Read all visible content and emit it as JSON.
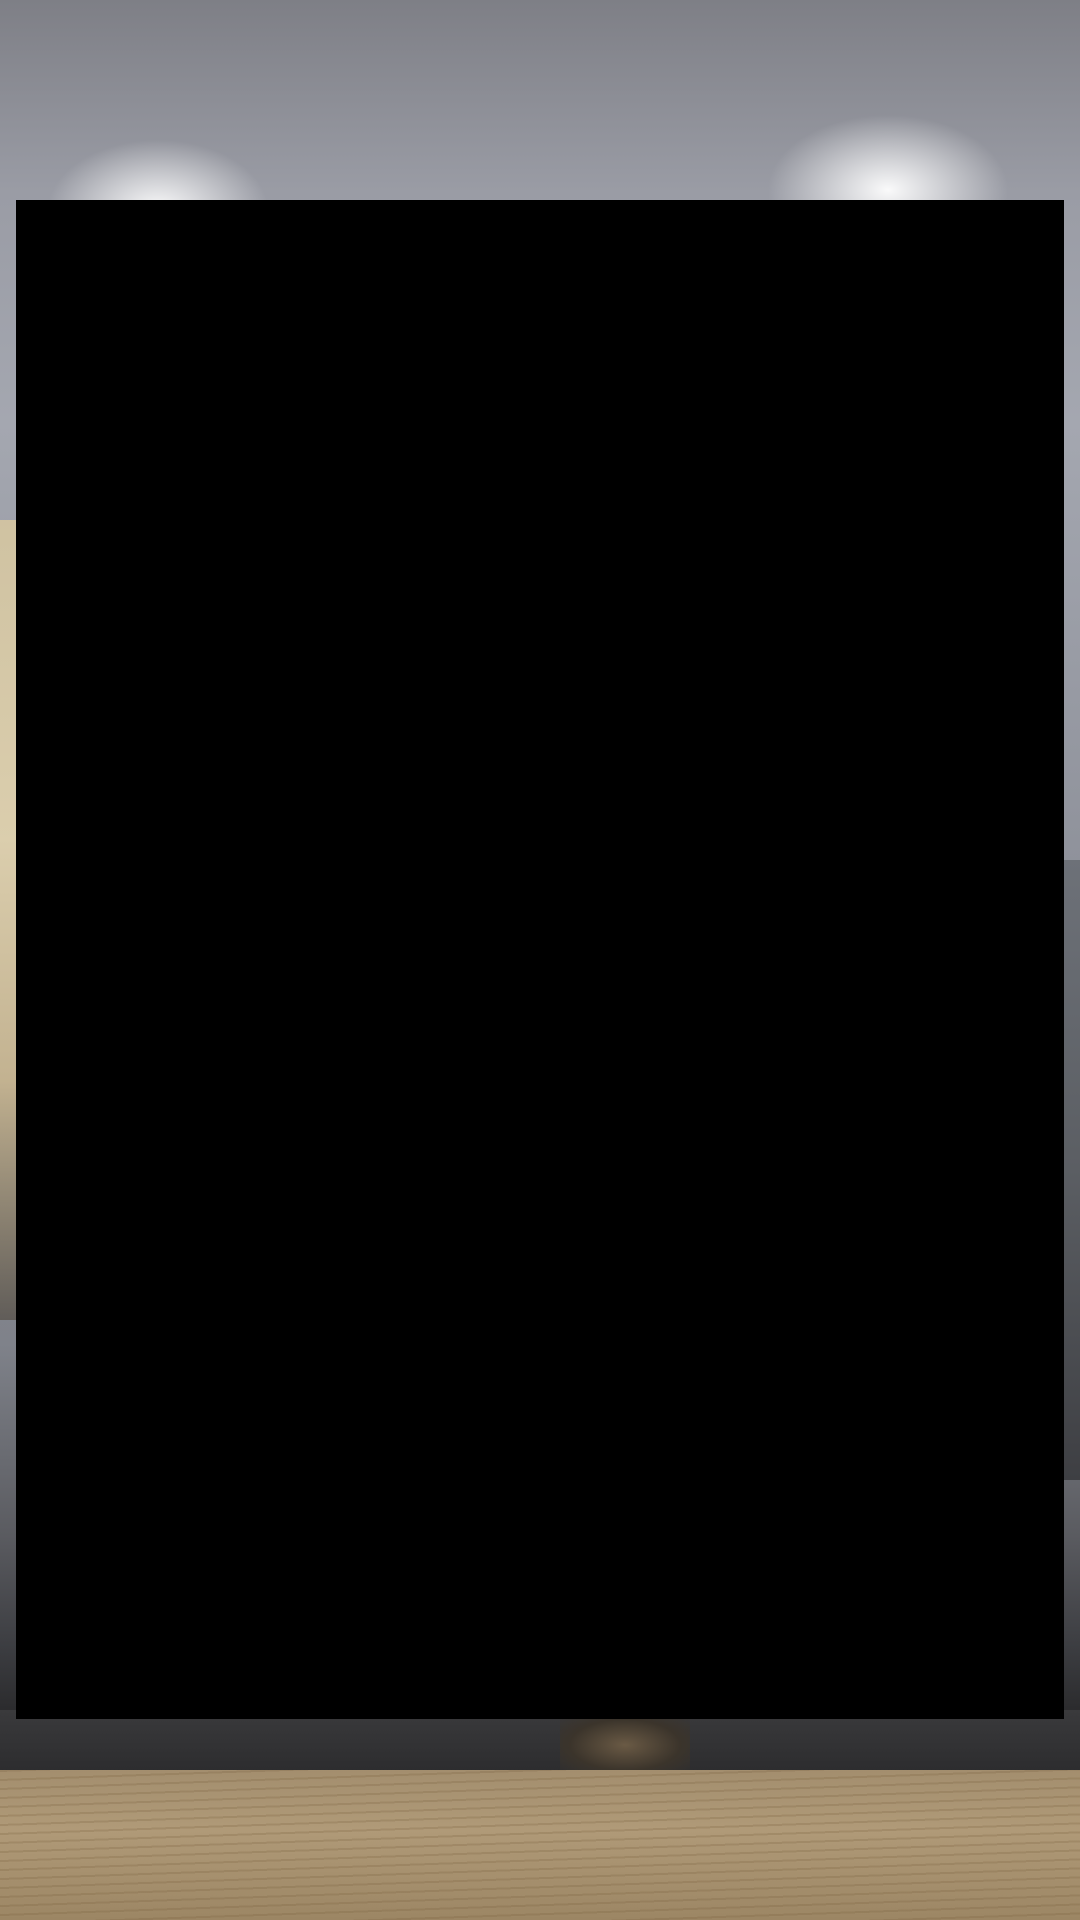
{
  "screen": {
    "background_description_colors": {
      "panel": "#000000",
      "wall": "#a4a7b0",
      "wood": "#b09a78",
      "fabric": "#2a2a2c"
    }
  }
}
